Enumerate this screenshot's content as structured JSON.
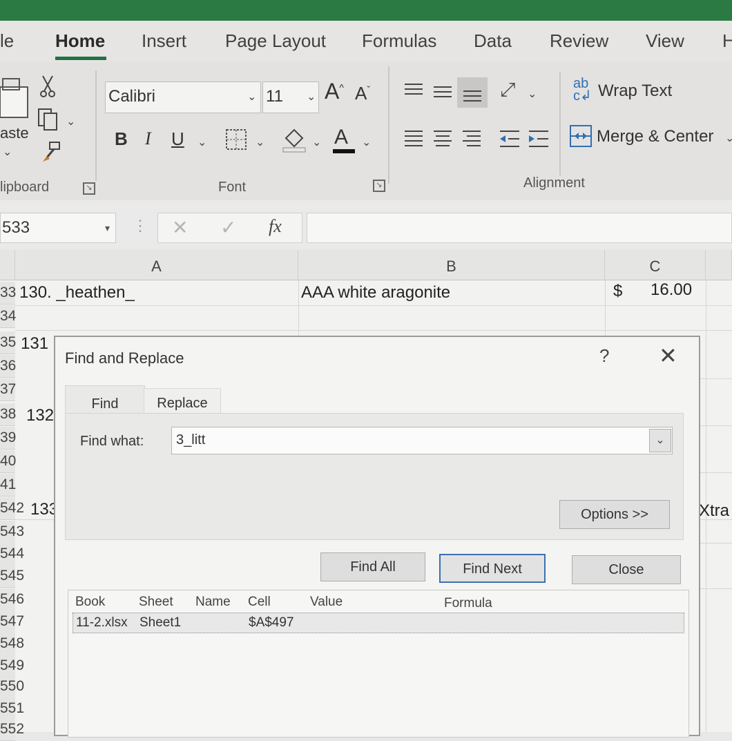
{
  "ribbon": {
    "tabs": [
      "le",
      "Home",
      "Insert",
      "Page Layout",
      "Formulas",
      "Data",
      "Review",
      "View",
      "H"
    ],
    "active_tab": "Home",
    "clipboard": {
      "paste_label": "aste",
      "group_label": "lipboard"
    },
    "font": {
      "name": "Calibri",
      "size": "11",
      "group_label": "Font",
      "bold": "B",
      "italic": "I",
      "underline": "U",
      "grow": "A",
      "shrink": "A",
      "color_a": "A"
    },
    "alignment": {
      "wrap_text": "Wrap Text",
      "merge_center": "Merge & Center",
      "group_label": "Alignment"
    }
  },
  "formula_bar": {
    "name_box": "533",
    "fx": "fx"
  },
  "grid": {
    "columns": [
      "A",
      "B",
      "C"
    ],
    "rows": [
      {
        "num": "33",
        "a": "130. _heathen_",
        "b": "AAA white aragonite",
        "c_symbol": "$",
        "c": "16.00"
      },
      {
        "num": "34",
        "a": ""
      },
      {
        "num": "35",
        "a": "131"
      },
      {
        "num": "36",
        "a": ""
      },
      {
        "num": "37",
        "a": ""
      },
      {
        "num": "38",
        "a": "132"
      },
      {
        "num": "39",
        "a": ""
      },
      {
        "num": "40",
        "a": ""
      },
      {
        "num": "41",
        "a": ""
      },
      {
        "num": "542",
        "a": "133"
      },
      {
        "num": "543",
        "a": ""
      },
      {
        "num": "544",
        "a": ""
      },
      {
        "num": "545",
        "a": ""
      },
      {
        "num": "546",
        "a": ""
      },
      {
        "num": "547",
        "a": ""
      },
      {
        "num": "548",
        "a": ""
      },
      {
        "num": "549",
        "a": ""
      },
      {
        "num": "550",
        "a": ""
      },
      {
        "num": "551",
        "a": ""
      },
      {
        "num": "552",
        "a": ""
      }
    ],
    "side_text": "Xtra"
  },
  "dialog": {
    "title": "Find and Replace",
    "help": "?",
    "close_icon": "✕",
    "tabs": {
      "find": "Find",
      "replace": "Replace"
    },
    "find_what_label": "Find what:",
    "find_what_value": "3_litt",
    "options": "Options >>",
    "find_all": "Find All",
    "find_next": "Find Next",
    "close": "Close",
    "results_headers": [
      "Book",
      "Sheet",
      "Name",
      "Cell",
      "Value",
      "Formula"
    ],
    "results": [
      {
        "book": "11-2.xlsx",
        "sheet": "Sheet1",
        "name": "",
        "cell": "$A$497",
        "value": "",
        "formula": ""
      }
    ]
  }
}
